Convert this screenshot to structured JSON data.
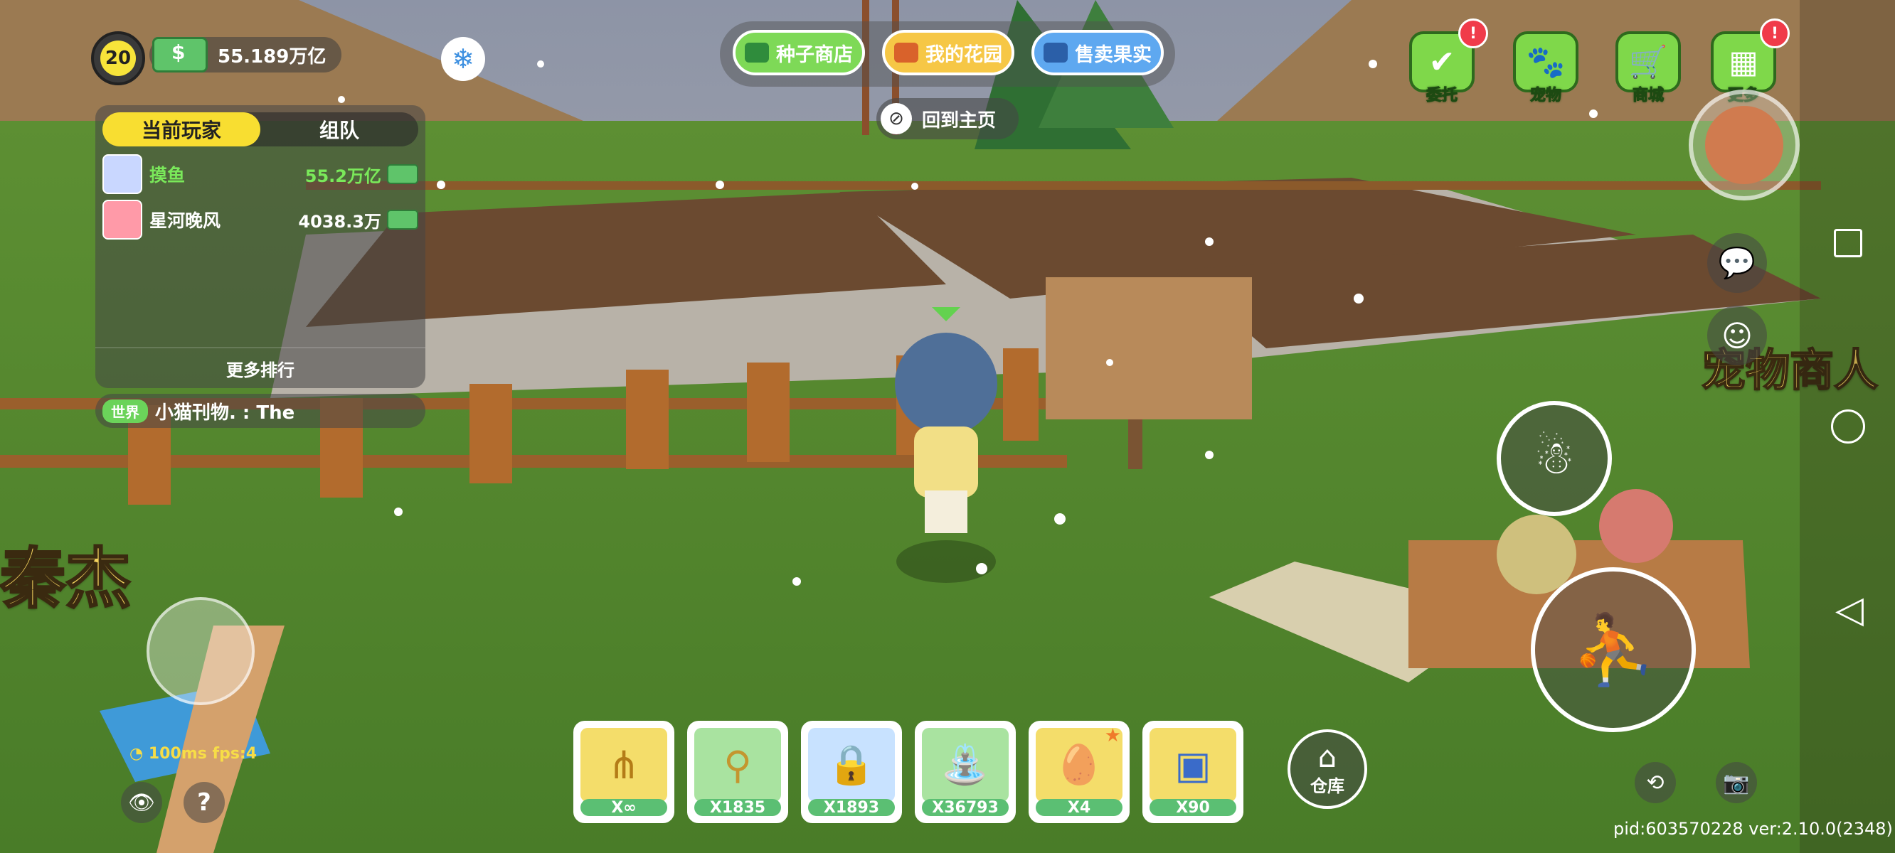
{
  "player": {
    "level": "20",
    "money": "55.189万亿"
  },
  "leaderboard": {
    "tabs": [
      "当前玩家",
      "组队"
    ],
    "rows": [
      {
        "name": "摸鱼",
        "value": "55.2万亿"
      },
      {
        "name": "星河晚风",
        "value": "4038.3万"
      }
    ],
    "more_label": "更多排行"
  },
  "chat": {
    "channel": "世界",
    "message": "小猫刊物. : The"
  },
  "top_nav": {
    "seed_shop": "种子商店",
    "my_garden": "我的花园",
    "sell_fruit": "售卖果实",
    "back_home": "回到主页"
  },
  "top_right_menu": [
    {
      "label": "委托",
      "alert": "!"
    },
    {
      "label": "宠物",
      "alert": ""
    },
    {
      "label": "商城",
      "alert": ""
    },
    {
      "label": "更多",
      "alert": "!"
    }
  ],
  "world_labels": {
    "player_name": "秦杰",
    "npc_name": "宠物商人"
  },
  "hotbar": [
    {
      "icon": "pitchfork-icon",
      "count": "X∞",
      "color": "#f4dd6a"
    },
    {
      "icon": "magnifier-icon",
      "count": "X1835",
      "color": "#a9e3a0"
    },
    {
      "icon": "lock-icon",
      "count": "X1893",
      "color": "#c8e2ff"
    },
    {
      "icon": "watering-can-icon",
      "count": "X36793",
      "color": "#a9e3a0"
    },
    {
      "icon": "egg-icon",
      "count": "X4",
      "color": "#f4dd6a"
    },
    {
      "icon": "treasure-chest-icon",
      "count": "X90",
      "color": "#f4dd6a"
    }
  ],
  "warehouse_label": "仓库",
  "network": {
    "ping": "100ms",
    "fps": "fps:4"
  },
  "version_info": "pid:603570228 ver:2.10.0(2348)"
}
